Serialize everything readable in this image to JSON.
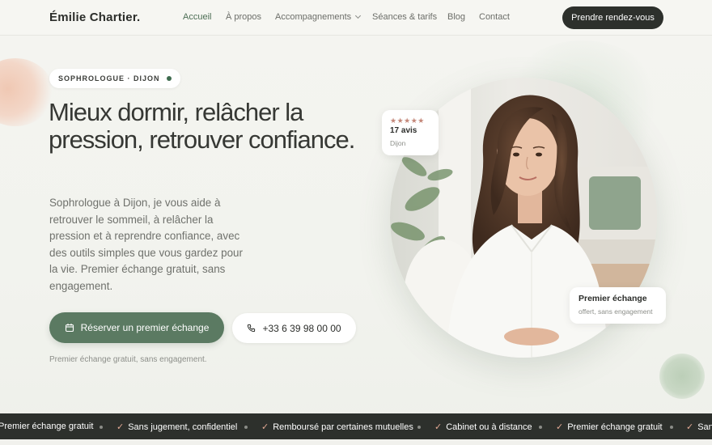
{
  "brand": "Émilie Chartier.",
  "nav": {
    "items": [
      "Accueil",
      "À propos",
      "Accompagnements",
      "Séances & tarifs",
      "Blog",
      "Contact"
    ],
    "active": "Accueil"
  },
  "header_cta": "Prendre rendez-vous",
  "hero": {
    "tag": "SOPHROLOGUE · DIJON",
    "headline": "Mieux dormir, relâcher la pression, retrouver confiance.",
    "lead": "Sophrologue à Dijon, je vous aide à retrouver le sommeil, à relâcher la pression et à reprendre confiance, avec des outils simples que vous gardez pour la vie. Premier échange gratuit, sans engagement.",
    "primary_button": "Réserver un premier échange",
    "phone_button": "+33 6 39 98 00 00",
    "note": "Premier échange gratuit, sans engagement."
  },
  "reviews_card": {
    "stars": "★★★★★",
    "count": "17 avis",
    "city": "Dijon"
  },
  "offer_card": {
    "title": "Premier échange",
    "subtitle": "offert, sans engagement"
  },
  "ticker": {
    "items": [
      "Premier échange gratuit",
      "Sans jugement, confidentiel",
      "Remboursé par certaines mutuelles",
      "Cabinet ou à distance",
      "Premier échange gratuit",
      "Sans jugement, confidentiel"
    ],
    "check": "✓"
  },
  "colors": {
    "accent_green": "#5b7a62",
    "dark": "#2d302c",
    "active_nav": "#4d6e55",
    "star": "#c48779"
  },
  "icons": [
    "calendar-icon",
    "phone-icon",
    "chevron-down-icon",
    "check-icon"
  ]
}
